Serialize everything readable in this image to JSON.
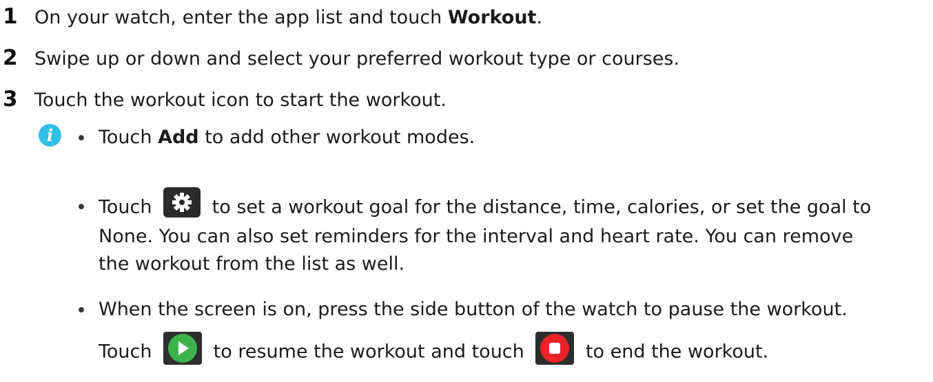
{
  "steps": [
    {
      "num": "1",
      "pre": "On your watch, enter the app list and touch ",
      "bold": "Workout",
      "post": "."
    },
    {
      "num": "2",
      "text": "Swipe up or down and select your preferred workout type or courses."
    },
    {
      "num": "3",
      "text": "Touch the workout icon to start the workout."
    }
  ],
  "note": {
    "icon": "info-icon",
    "icon_glyph": "i",
    "bullet_glyph": "•",
    "b1": {
      "pre": "Touch ",
      "bold": "Add",
      "post": " to add other workout modes."
    },
    "b2": {
      "pre": "Touch ",
      "line1_post": " to set a workout goal for the distance, time, calories, or set the goal to",
      "line2": "None. You can also set reminders for the interval and heart rate. You can remove",
      "line3": "the workout from the list as well."
    },
    "b3": {
      "line1": "When the screen is on, press the side button of the watch to pause the workout.",
      "line2_pre": "Touch ",
      "line2_mid": " to resume the workout and touch ",
      "line2_post": " to end the workout."
    }
  },
  "colors": {
    "info": "#33bfe4",
    "play": "#3cb44b",
    "stop": "#e8232a",
    "gear_bg": "#2b2b2b"
  }
}
